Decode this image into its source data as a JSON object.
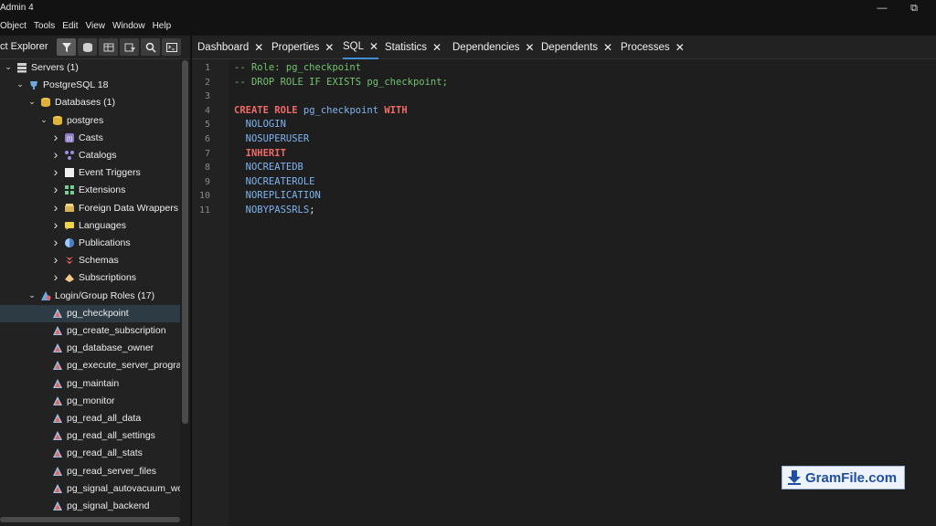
{
  "window": {
    "title": "Admin 4",
    "minimize_icon": "minimize-icon",
    "restore_icon": "restore-icon"
  },
  "menu": [
    "Object",
    "Tools",
    "Edit",
    "View",
    "Window",
    "Help"
  ],
  "explorer": {
    "title": "ct Explorer",
    "tools": [
      "filter-icon",
      "query-tool-icon",
      "table-view-icon",
      "filtered-rows-icon",
      "search-icon",
      "terminal-icon"
    ]
  },
  "tree": [
    {
      "label": "Servers (1)",
      "icon": "servers-icon",
      "caret": "down"
    },
    {
      "label": "PostgreSQL 18",
      "icon": "elephant-icon",
      "caret": "down"
    },
    {
      "label": "Databases (1)",
      "icon": "databases-icon",
      "caret": "down"
    },
    {
      "label": "postgres",
      "icon": "database-icon",
      "caret": "down"
    },
    {
      "label": "Casts",
      "icon": "casts-icon",
      "caret": "right"
    },
    {
      "label": "Catalogs",
      "icon": "catalogs-icon",
      "caret": "right"
    },
    {
      "label": "Event Triggers",
      "icon": "event-triggers-icon",
      "caret": "right"
    },
    {
      "label": "Extensions",
      "icon": "extensions-icon",
      "caret": "right"
    },
    {
      "label": "Foreign Data Wrappers",
      "icon": "fdw-icon",
      "caret": "right"
    },
    {
      "label": "Languages",
      "icon": "languages-icon",
      "caret": "right"
    },
    {
      "label": "Publications",
      "icon": "publications-icon",
      "caret": "right"
    },
    {
      "label": "Schemas",
      "icon": "schemas-icon",
      "caret": "right"
    },
    {
      "label": "Subscriptions",
      "icon": "subscriptions-icon",
      "caret": "right"
    },
    {
      "label": "Login/Group Roles (17)",
      "icon": "roles-icon",
      "caret": "down"
    },
    {
      "label": "pg_checkpoint",
      "icon": "role-icon",
      "caret": "",
      "selected": true
    },
    {
      "label": "pg_create_subscription",
      "icon": "role-icon",
      "caret": ""
    },
    {
      "label": "pg_database_owner",
      "icon": "role-icon",
      "caret": ""
    },
    {
      "label": "pg_execute_server_program",
      "icon": "role-icon",
      "caret": ""
    },
    {
      "label": "pg_maintain",
      "icon": "role-icon",
      "caret": ""
    },
    {
      "label": "pg_monitor",
      "icon": "role-icon",
      "caret": ""
    },
    {
      "label": "pg_read_all_data",
      "icon": "role-icon",
      "caret": ""
    },
    {
      "label": "pg_read_all_settings",
      "icon": "role-icon",
      "caret": ""
    },
    {
      "label": "pg_read_all_stats",
      "icon": "role-icon",
      "caret": ""
    },
    {
      "label": "pg_read_server_files",
      "icon": "role-icon",
      "caret": ""
    },
    {
      "label": "pg_signal_autovacuum_worker",
      "icon": "role-icon",
      "caret": ""
    },
    {
      "label": "pg_signal_backend",
      "icon": "role-icon",
      "caret": ""
    }
  ],
  "tabs": [
    {
      "label": "Dashboard",
      "active": false
    },
    {
      "label": "Properties",
      "active": false
    },
    {
      "label": "SQL",
      "active": true
    },
    {
      "label": "Statistics",
      "active": false
    },
    {
      "label": "Dependencies",
      "active": false
    },
    {
      "label": "Dependents",
      "active": false
    },
    {
      "label": "Processes",
      "active": false
    }
  ],
  "editor": {
    "lines": [
      [
        {
          "t": "-- Role: pg_checkpoint",
          "c": "cm"
        }
      ],
      [
        {
          "t": "-- DROP ROLE IF EXISTS pg_checkpoint;",
          "c": "cm"
        }
      ],
      [],
      [
        {
          "t": "CREATE ROLE",
          "c": "kw"
        },
        {
          "t": " pg_checkpoint ",
          "c": "id"
        },
        {
          "t": "WITH",
          "c": "kw"
        }
      ],
      [
        {
          "t": "  NOLOGIN",
          "c": "at"
        }
      ],
      [
        {
          "t": "  NOSUPERUSER",
          "c": "at"
        }
      ],
      [
        {
          "t": "  INHERIT",
          "c": "kw"
        }
      ],
      [
        {
          "t": "  NOCREATEDB",
          "c": "at"
        }
      ],
      [
        {
          "t": "  NOCREATEROLE",
          "c": "at"
        }
      ],
      [
        {
          "t": "  NOREPLICATION",
          "c": "at"
        }
      ],
      [
        {
          "t": "  NOBYPASSRLS",
          "c": "at"
        },
        {
          "t": ";",
          "c": "pl"
        }
      ]
    ]
  },
  "watermark": {
    "text": "GramFile.com",
    "icon": "download-arrow-icon"
  },
  "colors": {
    "accent": "#3f8ed6",
    "comment": "#73c270",
    "keyword": "#f06a6a",
    "identifier": "#7fb4f0"
  }
}
